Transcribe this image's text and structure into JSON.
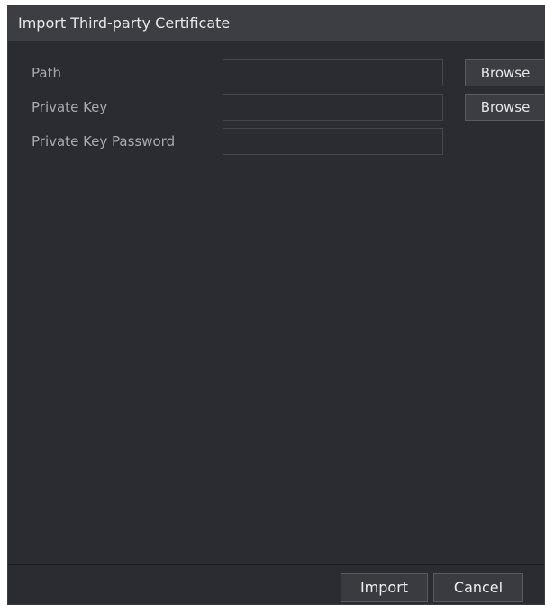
{
  "dialog": {
    "title": "Import Third-party Certificate"
  },
  "form": {
    "path": {
      "label": "Path",
      "value": "",
      "button_label": "Browse"
    },
    "private_key": {
      "label": "Private Key",
      "value": "",
      "button_label": "Browse"
    },
    "private_key_password": {
      "label": "Private Key Password",
      "value": ""
    }
  },
  "footer": {
    "import_label": "Import",
    "cancel_label": "Cancel"
  },
  "colors": {
    "dialog_background": "#2b2c31",
    "title_background": "#3d3e43",
    "label_text": "#a9aaad",
    "button_background": "#3c3d42"
  }
}
